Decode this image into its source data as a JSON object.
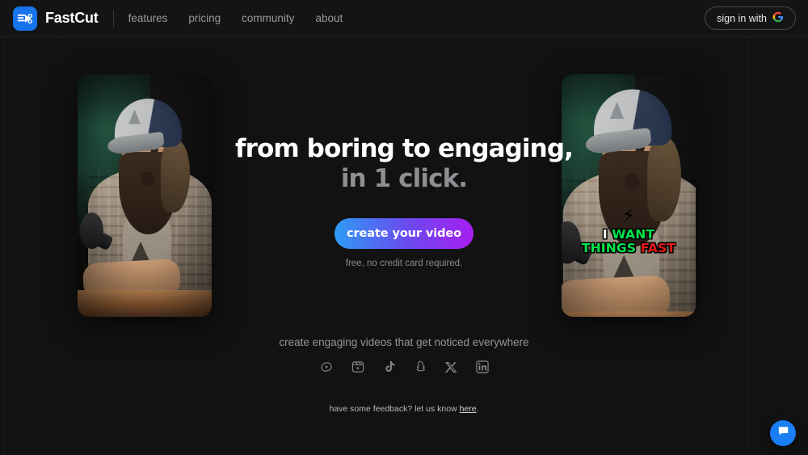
{
  "header": {
    "brand_name": "FastCut",
    "logo_icon": "fastcut-logo-icon",
    "nav": [
      {
        "label": "features"
      },
      {
        "label": "pricing"
      },
      {
        "label": "community"
      },
      {
        "label": "about"
      }
    ],
    "signin_label": "sign in with",
    "signin_icon": "google-g-icon"
  },
  "hero": {
    "headline_line1": "from boring to engaging,",
    "headline_line2": "in 1 click.",
    "cta_label": "create your video",
    "cta_subtext": "free, no credit card required.",
    "cta_gradient_from": "#2e9bf5",
    "cta_gradient_to": "#a81ef0",
    "left_video": {
      "alt": "podcast clip of bearded man in baseball cap speaking into microphone"
    },
    "right_video": {
      "alt": "same podcast clip with auto-generated captions",
      "caption_emoji": "⚡",
      "caption_word1": "I",
      "caption_word2": "WANT",
      "caption_word3": "THINGS",
      "caption_word4": "FAST",
      "caption_color_white": "#ffffff",
      "caption_color_green": "#00e64a",
      "caption_color_red": "#e91616"
    }
  },
  "footer": {
    "tagline": "create engaging videos that get noticed everywhere",
    "socials": [
      {
        "name": "youtube-shorts-icon",
        "label": "YouTube Shorts"
      },
      {
        "name": "instagram-reels-icon",
        "label": "Instagram Reels"
      },
      {
        "name": "tiktok-icon",
        "label": "TikTok"
      },
      {
        "name": "snapchat-icon",
        "label": "Snapchat"
      },
      {
        "name": "x-icon",
        "label": "X"
      },
      {
        "name": "linkedin-icon",
        "label": "LinkedIn"
      }
    ],
    "feedback_prefix": "have some feedback? let us know ",
    "feedback_link": "here",
    "feedback_suffix": "."
  },
  "chat": {
    "icon": "chat-bubble-icon"
  }
}
